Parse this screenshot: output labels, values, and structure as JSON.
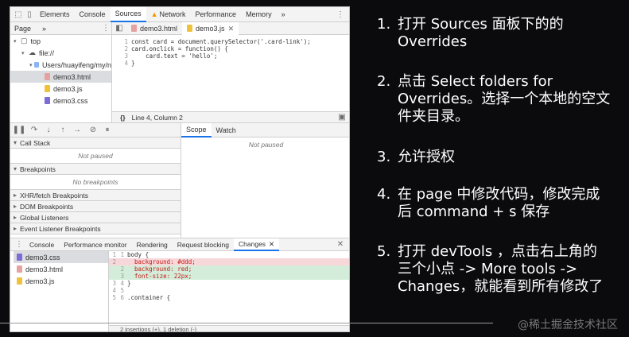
{
  "devtools": {
    "tabs": [
      "Elements",
      "Console",
      "Sources",
      "Network",
      "Performance",
      "Memory"
    ],
    "more": "»",
    "active_tab": "Sources",
    "navigator": {
      "tab": "Page",
      "more": "»",
      "tree": [
        {
          "label": "top",
          "indent": 0,
          "type": "frame"
        },
        {
          "label": "file://",
          "indent": 1,
          "type": "cloud"
        },
        {
          "label": "Users/huayifeng/my/n",
          "indent": 2,
          "type": "folder"
        },
        {
          "label": "demo3.html",
          "indent": 3,
          "type": "html",
          "selected": true
        },
        {
          "label": "demo3.js",
          "indent": 3,
          "type": "js"
        },
        {
          "label": "demo3.css",
          "indent": 3,
          "type": "css"
        }
      ]
    },
    "editor": {
      "tabs": [
        {
          "label": "demo3.html",
          "active": false
        },
        {
          "label": "demo3.js",
          "active": true
        }
      ],
      "code_lines": [
        "const card = document.querySelector('.card-link');",
        "card.onclick = function() {",
        "    card.text = 'hello';",
        "}"
      ],
      "status": "Line 4, Column 2",
      "pretty_print": "{}"
    },
    "debugger": {
      "sections": [
        {
          "title": "Call Stack",
          "body": "Not paused",
          "expanded": true
        },
        {
          "title": "Breakpoints",
          "body": "No breakpoints",
          "expanded": true
        },
        {
          "title": "XHR/fetch Breakpoints",
          "expanded": false
        },
        {
          "title": "DOM Breakpoints",
          "expanded": false
        },
        {
          "title": "Global Listeners",
          "expanded": false
        },
        {
          "title": "Event Listener Breakpoints",
          "expanded": false
        }
      ]
    },
    "scope": {
      "tabs": [
        "Scope",
        "Watch"
      ],
      "body": "Not paused"
    },
    "drawer": {
      "tabs": [
        "Console",
        "Performance monitor",
        "Rendering",
        "Request blocking",
        "Changes"
      ],
      "active": "Changes",
      "files": [
        {
          "label": "demo3.css",
          "type": "css",
          "selected": true
        },
        {
          "label": "demo3.html",
          "type": "html"
        },
        {
          "label": "demo3.js",
          "type": "js"
        }
      ],
      "diff": [
        {
          "a": "1",
          "b": "1",
          "text": "body {",
          "kind": "ctx"
        },
        {
          "a": "2",
          "b": "",
          "text": "  background: #ddd;",
          "kind": "del"
        },
        {
          "a": "",
          "b": "2",
          "text": "  background: red;",
          "kind": "add"
        },
        {
          "a": "",
          "b": "3",
          "text": "  font-size: 22px;",
          "kind": "add"
        },
        {
          "a": "3",
          "b": "4",
          "text": "}",
          "kind": "ctx"
        },
        {
          "a": "4",
          "b": "5",
          "text": "",
          "kind": "ctx"
        },
        {
          "a": "5",
          "b": "6",
          "text": ".container {",
          "kind": "ctx"
        }
      ],
      "summary": "2 insertions (+), 1 deletion (-)"
    }
  },
  "steps": [
    {
      "num": "1.",
      "text": "打开 Sources 面板下的的\nOverrides"
    },
    {
      "num": "2.",
      "text": "点击 Select folders for\nOverrides。选择一个本地的空文\n件夹目录。"
    },
    {
      "num": "3.",
      "text": "允许授权"
    },
    {
      "num": "4.",
      "text": "在 page 中修改代码，修改完成\n后 command + s 保存"
    },
    {
      "num": "5.",
      "text": "打开 devTools ，点击右上角的\n三个小点 -> More tools ->\nChanges，就能看到所有修改了"
    }
  ],
  "watermark": "@稀土掘金技术社区",
  "colors": {
    "accent": "#1a73e8",
    "warning": "#f29900",
    "html": "#e8a1a1",
    "js": "#f0c23b",
    "css": "#7b6cd8"
  }
}
